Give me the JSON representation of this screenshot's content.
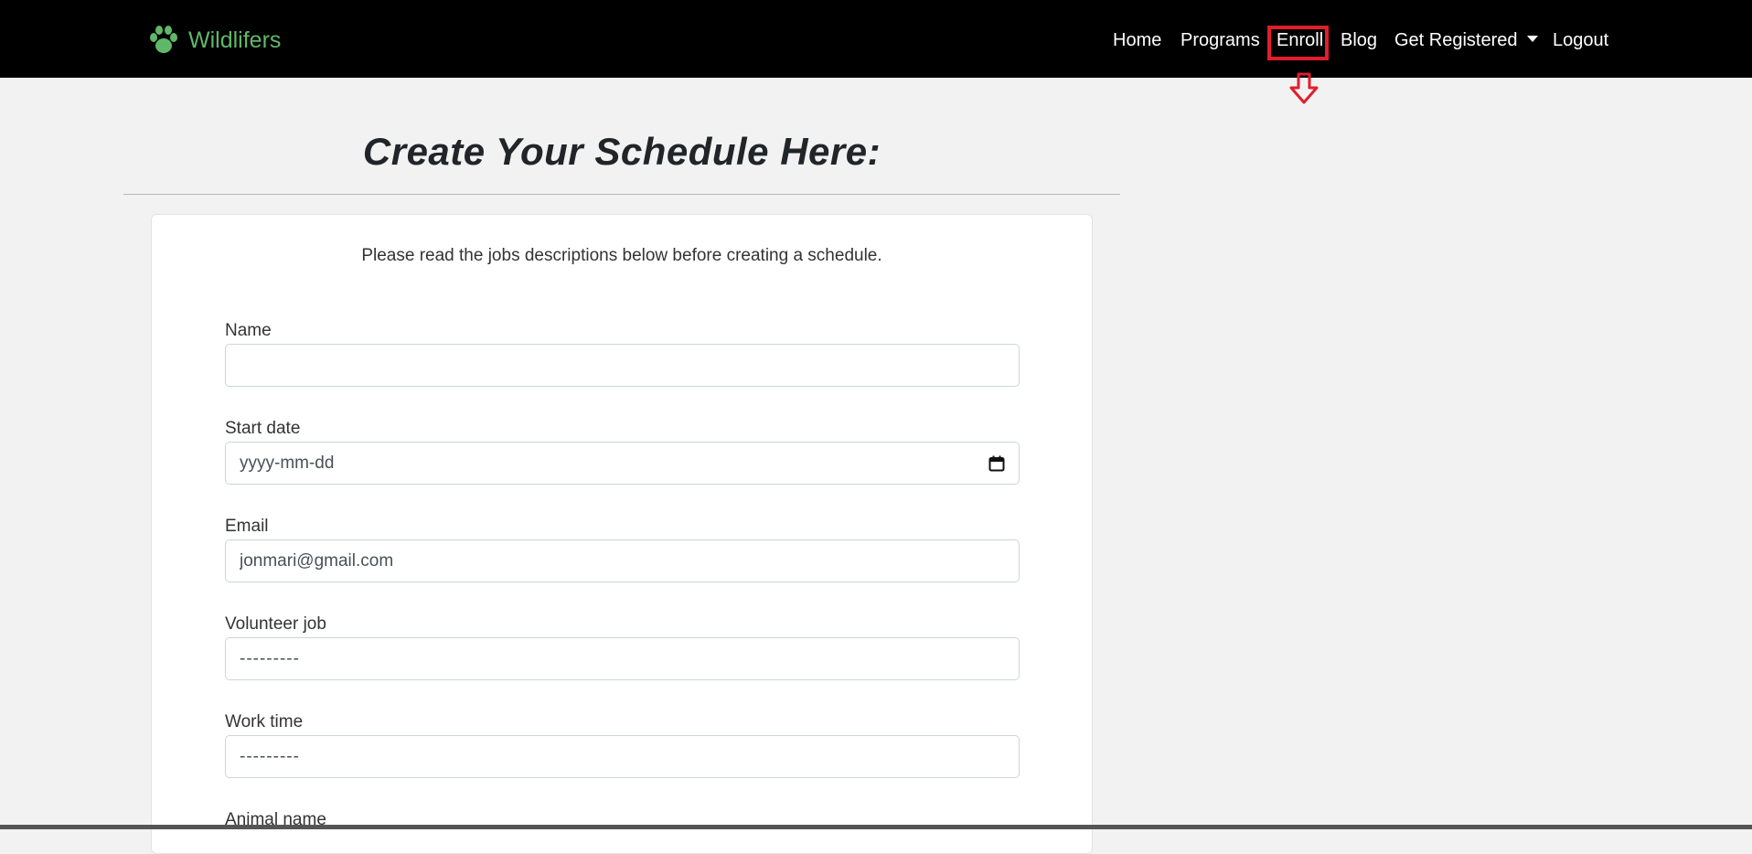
{
  "brand": {
    "name": "Wildlifers",
    "icon": "paw-icon",
    "color": "#5fb86a"
  },
  "nav": {
    "home": "Home",
    "programs": "Programs",
    "enroll": "Enroll",
    "blog": "Blog",
    "get_registered": "Get Registered",
    "logout": "Logout"
  },
  "annotation": {
    "highlight_color": "#e01e2b",
    "highlighted_item": "Enroll",
    "icon": "arrow-down-icon"
  },
  "page": {
    "title": "Create Your Schedule Here:",
    "intro": "Please read the jobs descriptions below before creating a schedule."
  },
  "form": {
    "name": {
      "label": "Name",
      "value": ""
    },
    "start_date": {
      "label": "Start date",
      "placeholder": "yyyy-mm-dd",
      "icon": "calendar-icon"
    },
    "email": {
      "label": "Email",
      "value": "jonmari@gmail.com"
    },
    "volunteer_job": {
      "label": "Volunteer job",
      "selected": "---------"
    },
    "work_time": {
      "label": "Work time",
      "selected": "---------"
    },
    "animal_name": {
      "label": "Animal name"
    }
  }
}
